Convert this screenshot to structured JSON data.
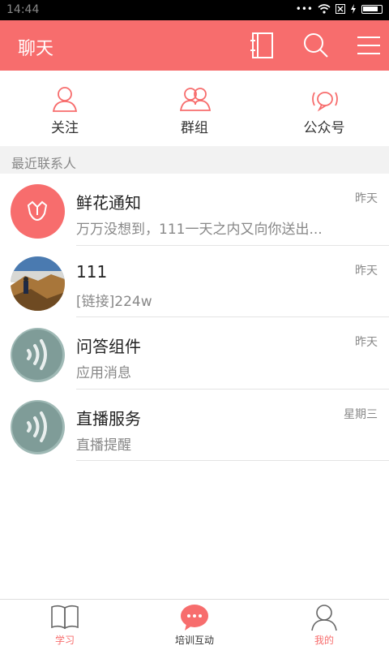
{
  "status_bar": {
    "time": "14:44",
    "icons": [
      "signal-dots-icon",
      "wifi-icon",
      "sim-x-icon",
      "charging-icon",
      "battery-icon"
    ]
  },
  "header": {
    "title": "聊天",
    "actions": [
      "contacts-book-icon",
      "search-icon",
      "menu-icon"
    ]
  },
  "tabs": [
    {
      "label": "关注",
      "icon": "person-icon"
    },
    {
      "label": "群组",
      "icon": "group-icon"
    },
    {
      "label": "公众号",
      "icon": "broadcast-icon"
    }
  ],
  "section_title": "最近联系人",
  "contacts": [
    {
      "name": "鲜花通知",
      "preview": "万万没想到，111一天之内又向你送出...",
      "time": "昨天",
      "avatar": "flower-avatar"
    },
    {
      "name": "111",
      "preview": "[链接]224w",
      "time": "昨天",
      "avatar": "photo-avatar"
    },
    {
      "name": "问答组件",
      "preview": "应用消息",
      "time": "昨天",
      "avatar": "sound-wave-avatar"
    },
    {
      "name": "直播服务",
      "preview": "直播提醒",
      "time": "星期三",
      "avatar": "sound-wave-avatar"
    }
  ],
  "bottom_nav": [
    {
      "label": "学习",
      "icon": "book-icon"
    },
    {
      "label": "培训互动",
      "icon": "chat-bubble-icon"
    },
    {
      "label": "我的",
      "icon": "user-icon"
    }
  ],
  "colors": {
    "accent": "#f76d6d",
    "status_bar": "#000000",
    "section_bg": "#f2f2f2",
    "text_primary": "#222222",
    "text_secondary": "#888888"
  }
}
